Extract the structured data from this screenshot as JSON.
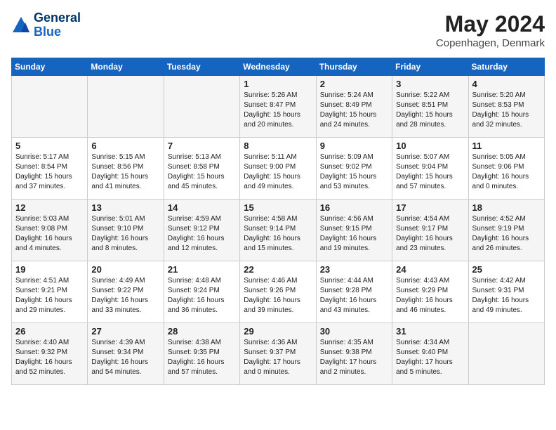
{
  "header": {
    "logo_general": "General",
    "logo_blue": "Blue",
    "month": "May 2024",
    "location": "Copenhagen, Denmark"
  },
  "weekdays": [
    "Sunday",
    "Monday",
    "Tuesday",
    "Wednesday",
    "Thursday",
    "Friday",
    "Saturday"
  ],
  "weeks": [
    [
      {
        "day": "",
        "info": ""
      },
      {
        "day": "",
        "info": ""
      },
      {
        "day": "",
        "info": ""
      },
      {
        "day": "1",
        "info": "Sunrise: 5:26 AM\nSunset: 8:47 PM\nDaylight: 15 hours\nand 20 minutes."
      },
      {
        "day": "2",
        "info": "Sunrise: 5:24 AM\nSunset: 8:49 PM\nDaylight: 15 hours\nand 24 minutes."
      },
      {
        "day": "3",
        "info": "Sunrise: 5:22 AM\nSunset: 8:51 PM\nDaylight: 15 hours\nand 28 minutes."
      },
      {
        "day": "4",
        "info": "Sunrise: 5:20 AM\nSunset: 8:53 PM\nDaylight: 15 hours\nand 32 minutes."
      }
    ],
    [
      {
        "day": "5",
        "info": "Sunrise: 5:17 AM\nSunset: 8:54 PM\nDaylight: 15 hours\nand 37 minutes."
      },
      {
        "day": "6",
        "info": "Sunrise: 5:15 AM\nSunset: 8:56 PM\nDaylight: 15 hours\nand 41 minutes."
      },
      {
        "day": "7",
        "info": "Sunrise: 5:13 AM\nSunset: 8:58 PM\nDaylight: 15 hours\nand 45 minutes."
      },
      {
        "day": "8",
        "info": "Sunrise: 5:11 AM\nSunset: 9:00 PM\nDaylight: 15 hours\nand 49 minutes."
      },
      {
        "day": "9",
        "info": "Sunrise: 5:09 AM\nSunset: 9:02 PM\nDaylight: 15 hours\nand 53 minutes."
      },
      {
        "day": "10",
        "info": "Sunrise: 5:07 AM\nSunset: 9:04 PM\nDaylight: 15 hours\nand 57 minutes."
      },
      {
        "day": "11",
        "info": "Sunrise: 5:05 AM\nSunset: 9:06 PM\nDaylight: 16 hours\nand 0 minutes."
      }
    ],
    [
      {
        "day": "12",
        "info": "Sunrise: 5:03 AM\nSunset: 9:08 PM\nDaylight: 16 hours\nand 4 minutes."
      },
      {
        "day": "13",
        "info": "Sunrise: 5:01 AM\nSunset: 9:10 PM\nDaylight: 16 hours\nand 8 minutes."
      },
      {
        "day": "14",
        "info": "Sunrise: 4:59 AM\nSunset: 9:12 PM\nDaylight: 16 hours\nand 12 minutes."
      },
      {
        "day": "15",
        "info": "Sunrise: 4:58 AM\nSunset: 9:14 PM\nDaylight: 16 hours\nand 15 minutes."
      },
      {
        "day": "16",
        "info": "Sunrise: 4:56 AM\nSunset: 9:15 PM\nDaylight: 16 hours\nand 19 minutes."
      },
      {
        "day": "17",
        "info": "Sunrise: 4:54 AM\nSunset: 9:17 PM\nDaylight: 16 hours\nand 23 minutes."
      },
      {
        "day": "18",
        "info": "Sunrise: 4:52 AM\nSunset: 9:19 PM\nDaylight: 16 hours\nand 26 minutes."
      }
    ],
    [
      {
        "day": "19",
        "info": "Sunrise: 4:51 AM\nSunset: 9:21 PM\nDaylight: 16 hours\nand 29 minutes."
      },
      {
        "day": "20",
        "info": "Sunrise: 4:49 AM\nSunset: 9:22 PM\nDaylight: 16 hours\nand 33 minutes."
      },
      {
        "day": "21",
        "info": "Sunrise: 4:48 AM\nSunset: 9:24 PM\nDaylight: 16 hours\nand 36 minutes."
      },
      {
        "day": "22",
        "info": "Sunrise: 4:46 AM\nSunset: 9:26 PM\nDaylight: 16 hours\nand 39 minutes."
      },
      {
        "day": "23",
        "info": "Sunrise: 4:44 AM\nSunset: 9:28 PM\nDaylight: 16 hours\nand 43 minutes."
      },
      {
        "day": "24",
        "info": "Sunrise: 4:43 AM\nSunset: 9:29 PM\nDaylight: 16 hours\nand 46 minutes."
      },
      {
        "day": "25",
        "info": "Sunrise: 4:42 AM\nSunset: 9:31 PM\nDaylight: 16 hours\nand 49 minutes."
      }
    ],
    [
      {
        "day": "26",
        "info": "Sunrise: 4:40 AM\nSunset: 9:32 PM\nDaylight: 16 hours\nand 52 minutes."
      },
      {
        "day": "27",
        "info": "Sunrise: 4:39 AM\nSunset: 9:34 PM\nDaylight: 16 hours\nand 54 minutes."
      },
      {
        "day": "28",
        "info": "Sunrise: 4:38 AM\nSunset: 9:35 PM\nDaylight: 16 hours\nand 57 minutes."
      },
      {
        "day": "29",
        "info": "Sunrise: 4:36 AM\nSunset: 9:37 PM\nDaylight: 17 hours\nand 0 minutes."
      },
      {
        "day": "30",
        "info": "Sunrise: 4:35 AM\nSunset: 9:38 PM\nDaylight: 17 hours\nand 2 minutes."
      },
      {
        "day": "31",
        "info": "Sunrise: 4:34 AM\nSunset: 9:40 PM\nDaylight: 17 hours\nand 5 minutes."
      },
      {
        "day": "",
        "info": ""
      }
    ]
  ]
}
